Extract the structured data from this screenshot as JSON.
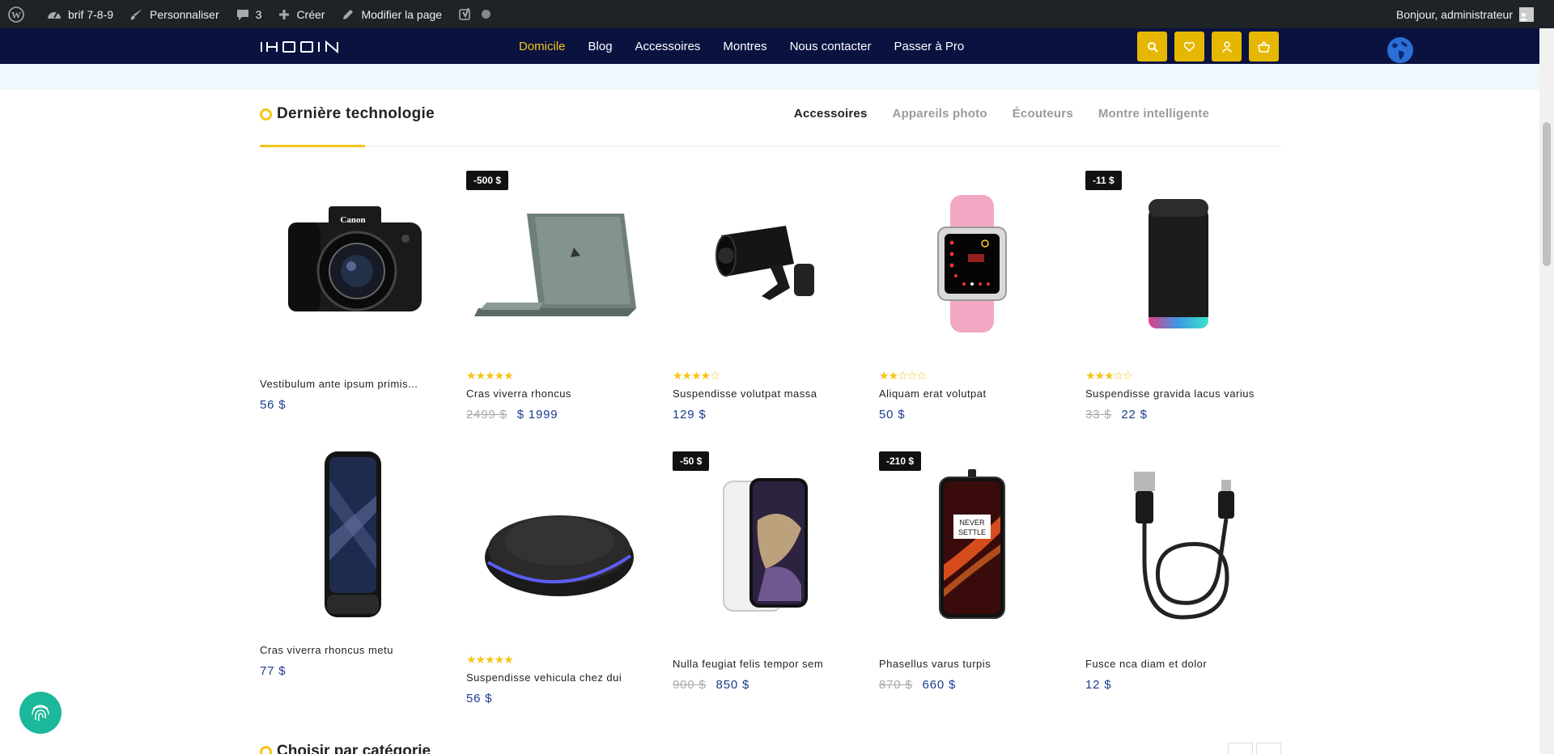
{
  "adminbar": {
    "site_name": "brif 7-8-9",
    "customize": "Personnaliser",
    "comments_count": "3",
    "new": "Créer",
    "edit_page": "Modifier la page",
    "greeting": "Bonjour, administrateur"
  },
  "header": {
    "nav": [
      "Domicile",
      "Blog",
      "Accessoires",
      "Montres",
      "Nous contacter",
      "Passer à Pro"
    ],
    "active_nav": "Domicile",
    "accent_color": "#f5c518",
    "bg_color": "#0a1240"
  },
  "section": {
    "title": "Dernière technologie",
    "tabs": [
      "Accessoires",
      "Appareils photo",
      "Écouteurs",
      "Montre intelligente"
    ],
    "active_tab": "Accessoires",
    "next_title": "Choisir par catégorie"
  },
  "products": [
    {
      "name": "Vestibulum ante ipsum primis...",
      "price": "56 $",
      "old_price": "",
      "badge": "",
      "rating": 0,
      "image": "camera"
    },
    {
      "name": "Cras viverra rhoncus",
      "price": "$ 1999",
      "old_price": "2499 $",
      "badge": "-500 $",
      "rating": 5,
      "image": "laptop"
    },
    {
      "name": "Suspendisse volutpat massa",
      "price": "129 $",
      "old_price": "",
      "badge": "",
      "rating": 4,
      "image": "security-camera"
    },
    {
      "name": "Aliquam erat volutpat",
      "price": "50 $",
      "old_price": "",
      "badge": "",
      "rating": 2,
      "image": "smartwatch"
    },
    {
      "name": "Suspendisse gravida lacus varius",
      "price": "22 $",
      "old_price": "33 $",
      "badge": "-11 $",
      "rating": 3,
      "image": "speaker"
    },
    {
      "name": "Cras viverra rhoncus metu",
      "price": "77 $",
      "old_price": "",
      "badge": "",
      "rating": 0,
      "image": "flip-phone"
    },
    {
      "name": "Suspendisse vehicula chez dui",
      "price": "56 $",
      "old_price": "",
      "badge": "",
      "rating": 5,
      "image": "wireless-charger"
    },
    {
      "name": "Nulla feugiat felis tempor sem",
      "price": "850 $",
      "old_price": "900 $",
      "badge": "-50 $",
      "rating": 0,
      "image": "iphone"
    },
    {
      "name": "Phasellus varus turpis",
      "price": "660 $",
      "old_price": "870 $",
      "badge": "-210 $",
      "rating": 0,
      "image": "oneplus-phone"
    },
    {
      "name": "Fusce nca diam et dolor",
      "price": "12 $",
      "old_price": "",
      "badge": "",
      "rating": 0,
      "image": "usb-cable"
    }
  ]
}
